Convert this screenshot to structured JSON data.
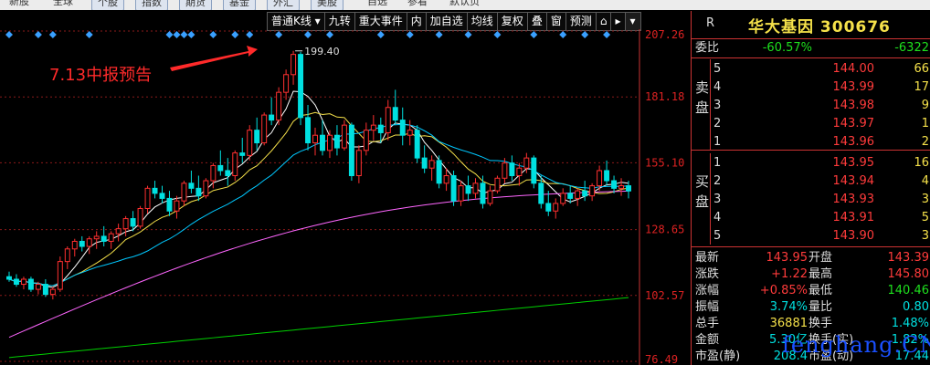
{
  "topbar": {
    "tabs": [
      "新股",
      "全球",
      "个股",
      "指数",
      "期货",
      "基金",
      "外汇",
      "美股",
      "自选",
      "参看",
      "默认页"
    ]
  },
  "toolbar": {
    "items": [
      "普通K线 ▾",
      "九转",
      "重大事件",
      "内",
      "加自选",
      "均线",
      "复权",
      "叠",
      "窗",
      "预测",
      "⌂",
      "▸"
    ],
    "period": "",
    "arrow_down": "▾"
  },
  "chart": {
    "y_ticks": [
      "207.26",
      "181.18",
      "155.10",
      "128.65",
      "102.57",
      "76.49"
    ],
    "high_label": "199.40",
    "annotation": "7.13中报预告",
    "colors": {
      "up": "#ff3030",
      "down": "#00e0e0",
      "ma5": "#ffffff",
      "ma10": "#f5e14a",
      "ma20": "#00c8ff",
      "ma60": "#ff66ff",
      "ma120": "#00d000"
    }
  },
  "chart_data": {
    "type": "candlestick",
    "ylim": [
      76.49,
      207.26
    ],
    "ohlc": [
      [
        110,
        112,
        108,
        109
      ],
      [
        109,
        111,
        106,
        107
      ],
      [
        107,
        110,
        105,
        109
      ],
      [
        109,
        110,
        104,
        105
      ],
      [
        105,
        108,
        103,
        107
      ],
      [
        107,
        109,
        102,
        103
      ],
      [
        103,
        106,
        101,
        105
      ],
      [
        105,
        118,
        104,
        116
      ],
      [
        116,
        122,
        113,
        121
      ],
      [
        121,
        125,
        118,
        124
      ],
      [
        124,
        126,
        120,
        122
      ],
      [
        122,
        126,
        119,
        125
      ],
      [
        125,
        128,
        121,
        126
      ],
      [
        126,
        130,
        122,
        124
      ],
      [
        124,
        128,
        121,
        127
      ],
      [
        127,
        131,
        124,
        129
      ],
      [
        129,
        134,
        126,
        133
      ],
      [
        133,
        136,
        128,
        130
      ],
      [
        130,
        138,
        129,
        137
      ],
      [
        137,
        146,
        135,
        145
      ],
      [
        145,
        148,
        141,
        143
      ],
      [
        143,
        146,
        139,
        141
      ],
      [
        141,
        144,
        134,
        136
      ],
      [
        136,
        142,
        133,
        140
      ],
      [
        140,
        148,
        138,
        147
      ],
      [
        147,
        152,
        143,
        145
      ],
      [
        145,
        150,
        140,
        142
      ],
      [
        142,
        149,
        141,
        148
      ],
      [
        148,
        155,
        145,
        154
      ],
      [
        154,
        160,
        150,
        152
      ],
      [
        152,
        157,
        146,
        150
      ],
      [
        150,
        160,
        148,
        159
      ],
      [
        159,
        165,
        155,
        158
      ],
      [
        158,
        170,
        156,
        168
      ],
      [
        168,
        173,
        160,
        163
      ],
      [
        163,
        175,
        162,
        174
      ],
      [
        174,
        181,
        170,
        172
      ],
      [
        172,
        185,
        170,
        183
      ],
      [
        183,
        192,
        180,
        190
      ],
      [
        190,
        199.4,
        186,
        198
      ],
      [
        198,
        199,
        170,
        173
      ],
      [
        173,
        178,
        160,
        163
      ],
      [
        163,
        169,
        158,
        166
      ],
      [
        166,
        172,
        158,
        160
      ],
      [
        160,
        168,
        157,
        166
      ],
      [
        166,
        170,
        158,
        161
      ],
      [
        161,
        172,
        160,
        170
      ],
      [
        170,
        171,
        148,
        150
      ],
      [
        150,
        162,
        147,
        160
      ],
      [
        160,
        171,
        158,
        168
      ],
      [
        168,
        174,
        164,
        170
      ],
      [
        170,
        173,
        163,
        167
      ],
      [
        167,
        180,
        164,
        177
      ],
      [
        177,
        184,
        170,
        172
      ],
      [
        172,
        177,
        162,
        166
      ],
      [
        166,
        172,
        162,
        168
      ],
      [
        168,
        170,
        155,
        157
      ],
      [
        157,
        162,
        151,
        153
      ],
      [
        153,
        158,
        148,
        156
      ],
      [
        156,
        158,
        145,
        147
      ],
      [
        147,
        153,
        144,
        150
      ],
      [
        150,
        152,
        138,
        140
      ],
      [
        140,
        148,
        138,
        146
      ],
      [
        146,
        150,
        140,
        143
      ],
      [
        143,
        149,
        141,
        147
      ],
      [
        147,
        150,
        137,
        139
      ],
      [
        139,
        146,
        138,
        144
      ],
      [
        144,
        150,
        143,
        149
      ],
      [
        149,
        157,
        147,
        155
      ],
      [
        155,
        158,
        148,
        150
      ],
      [
        150,
        155,
        146,
        153
      ],
      [
        153,
        159,
        151,
        157
      ],
      [
        157,
        158,
        145,
        147
      ],
      [
        147,
        150,
        137,
        139
      ],
      [
        139,
        144,
        134,
        136
      ],
      [
        136,
        141,
        133,
        139
      ],
      [
        139,
        145,
        138,
        143
      ],
      [
        143,
        146,
        139,
        141
      ],
      [
        141,
        145,
        138,
        144
      ],
      [
        144,
        148,
        140,
        142
      ],
      [
        142,
        147,
        140,
        146
      ],
      [
        146,
        154,
        144,
        152
      ],
      [
        152,
        156,
        146,
        148
      ],
      [
        148,
        150,
        143,
        145
      ],
      [
        145,
        149,
        142,
        146
      ],
      [
        146,
        148,
        141,
        143.95
      ]
    ],
    "markers_top": "diamond markers above candles"
  },
  "panel": {
    "header_r": "R",
    "title": "华大基因 300676",
    "weibi": {
      "label": "委比",
      "pct": "-60.57%",
      "val": "-6322"
    },
    "sell_label": "卖盘",
    "buy_label": "买盘",
    "sell": [
      {
        "i": "5",
        "p": "144.00",
        "v": "66"
      },
      {
        "i": "4",
        "p": "143.99",
        "v": "17"
      },
      {
        "i": "3",
        "p": "143.98",
        "v": "9"
      },
      {
        "i": "2",
        "p": "143.97",
        "v": "1"
      },
      {
        "i": "1",
        "p": "143.96",
        "v": "2"
      }
    ],
    "buy": [
      {
        "i": "1",
        "p": "143.95",
        "v": "16"
      },
      {
        "i": "2",
        "p": "143.94",
        "v": "4"
      },
      {
        "i": "3",
        "p": "143.93",
        "v": "3"
      },
      {
        "i": "4",
        "p": "143.91",
        "v": "5"
      },
      {
        "i": "5",
        "p": "143.90",
        "v": "3"
      }
    ],
    "quote": [
      {
        "l": "最新",
        "v": "143.95",
        "vc": "c-red",
        "l2": "开盘",
        "v2": "143.39",
        "vc2": "c-red"
      },
      {
        "l": "涨跌",
        "v": "+1.22",
        "vc": "c-red",
        "l2": "最高",
        "v2": "145.80",
        "vc2": "c-red"
      },
      {
        "l": "涨幅",
        "v": "+0.85%",
        "vc": "c-red",
        "l2": "最低",
        "v2": "140.46",
        "vc2": "c-grn"
      },
      {
        "l": "振幅",
        "v": "3.74%",
        "vc": "c-cyan",
        "l2": "量比",
        "v2": "0.80",
        "vc2": "c-cyan"
      },
      {
        "l": "总手",
        "v": "36881",
        "vc": "c-yel",
        "l2": "换手",
        "v2": "1.48%",
        "vc2": "c-cyan"
      },
      {
        "l": "金额",
        "v": "5.30亿",
        "vc": "c-cyan",
        "l2": "换手(实)",
        "v2": "1.82%",
        "vc2": "c-cyan"
      },
      {
        "l": "市盈(静)",
        "v": "208.4",
        "vc": "c-cyan",
        "l2": "市盈(动)",
        "v2": "17.44",
        "vc2": "c-cyan"
      }
    ]
  },
  "watermark": "fenghang.CN"
}
